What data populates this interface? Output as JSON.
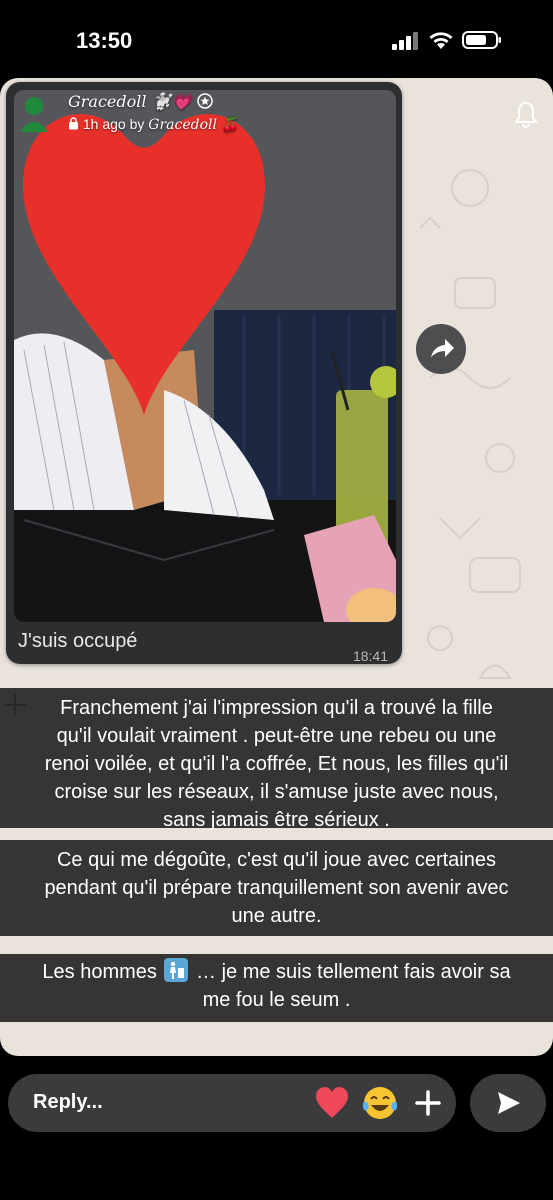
{
  "status_bar": {
    "time": "13:50"
  },
  "story": {
    "author_name": "Gracedoll 🐩💗",
    "meta_prefix": "1h ago by",
    "meta_author": "Gracedoll 🍒"
  },
  "chat_screenshot": {
    "caption": "J'suis occupé",
    "time": "18:41"
  },
  "text_overlays": {
    "band1": [
      "Franchement j'ai l'impression qu'il a trouvé la fille",
      "qu'il voulait vraiment . peut-être une rebeu ou une",
      "renoi voilée, et qu'il l'a coffrée, Et nous, les filles qu'il",
      "croise sur les réseaux, il s'amuse juste avec nous,",
      "sans jamais être sérieux ."
    ],
    "band2": [
      "Ce qui me dégoûte, c'est qu'il joue avec certaines",
      "pendant qu'il prépare tranquillement son avenir avec",
      "une autre."
    ],
    "band3_before_emoji": "Les hommes",
    "band3_after_emoji": "… je me suis tellement fais avoir sa",
    "band3_line2": "me fou le seum ."
  },
  "reply_bar": {
    "placeholder": "Reply..."
  },
  "icons": {
    "heart": "heart-emoji-icon",
    "laugh": "tears-of-joy-emoji-icon",
    "plus": "plus-icon",
    "send": "send-icon",
    "bell": "bell-icon",
    "forward": "forward-icon"
  }
}
